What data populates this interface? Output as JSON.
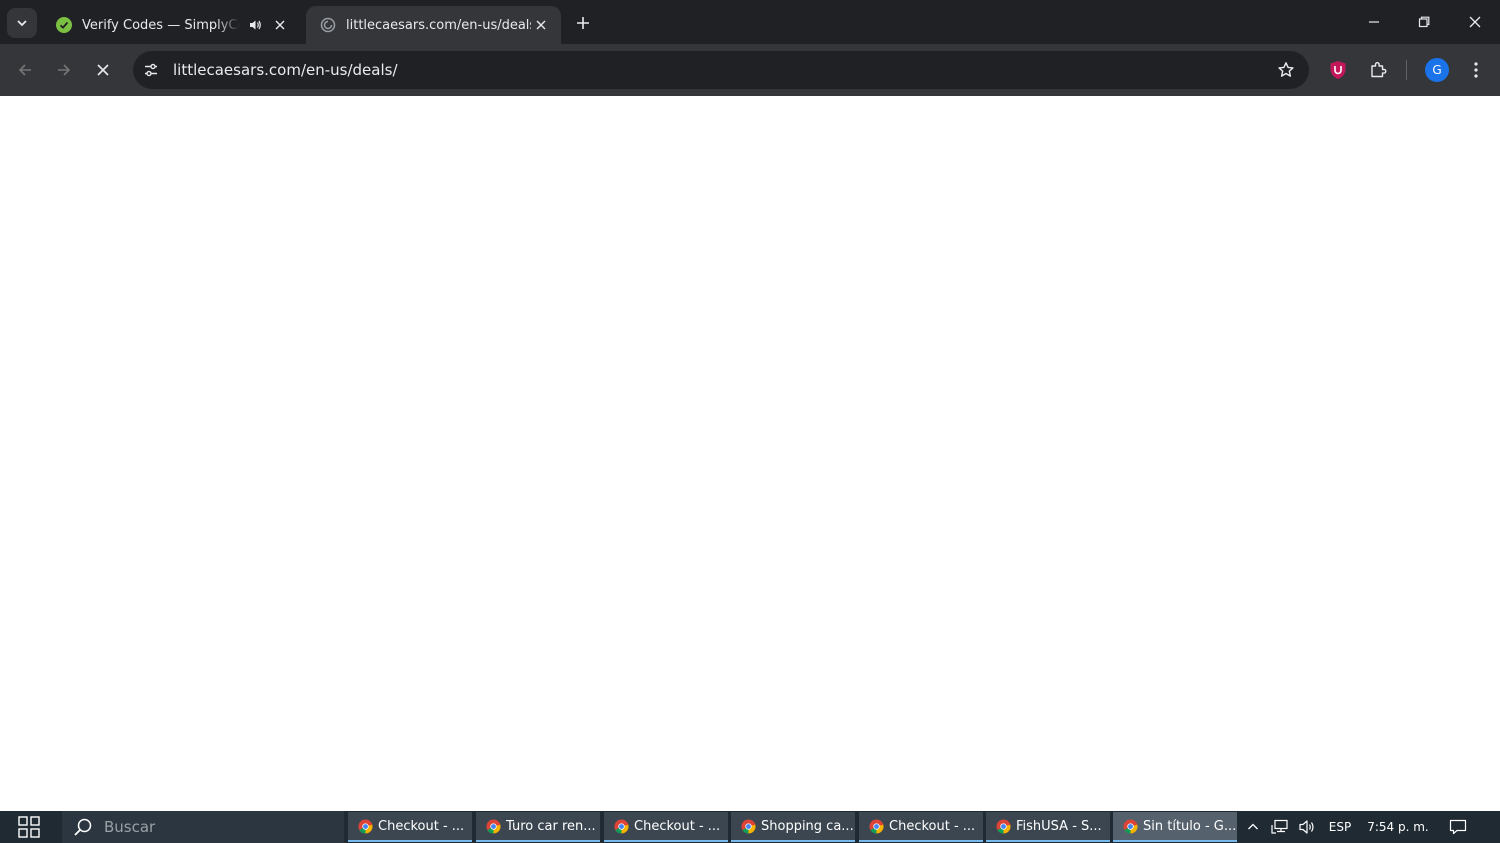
{
  "browser": {
    "tabs": [
      {
        "title": "Verify Codes — SimplyCodes",
        "active": false,
        "audio": true
      },
      {
        "title": "littlecaesars.com/en-us/deals/",
        "active": true,
        "audio": false
      }
    ],
    "url": "littlecaesars.com/en-us/deals/",
    "profile_initial": "G",
    "colors": {
      "titlebar": "#202124",
      "toolbar": "#35363a",
      "omnibox": "#202124",
      "text": "#e8eaed"
    }
  },
  "taskbar": {
    "search_placeholder": "Buscar",
    "apps": [
      {
        "label": "Checkout - ..."
      },
      {
        "label": "Turo car ren..."
      },
      {
        "label": "Checkout - ..."
      },
      {
        "label": "Shopping ca..."
      },
      {
        "label": "Checkout - ..."
      },
      {
        "label": "FishUSA - S..."
      },
      {
        "label": "Sin título - G..."
      }
    ],
    "language": "ESP",
    "time": "7:54 p. m."
  }
}
